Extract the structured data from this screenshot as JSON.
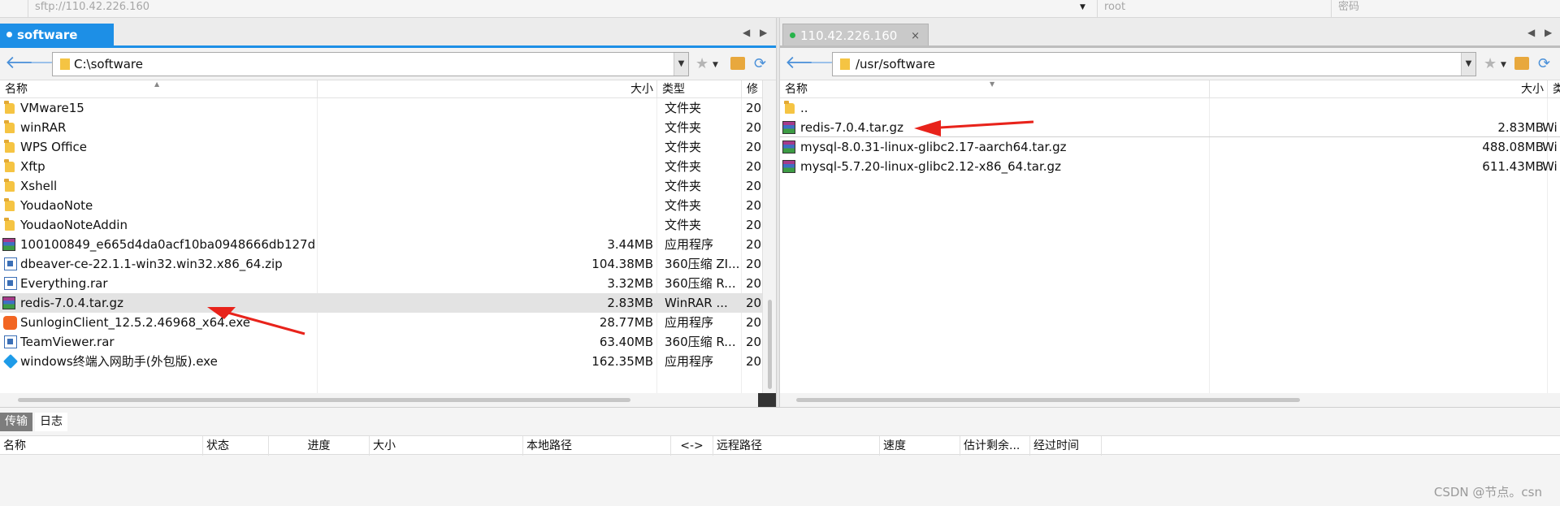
{
  "connection": {
    "host": "sftp://110.42.226.160",
    "user": "root",
    "password": "密码"
  },
  "local": {
    "tab": "software",
    "path": "C:\\software",
    "columns": {
      "name": "名称",
      "size": "大小",
      "type": "类型",
      "modified": "修"
    },
    "files": [
      {
        "name": "VMware15",
        "size": "",
        "type": "文件夹",
        "mod": "20",
        "icon": "folder"
      },
      {
        "name": "winRAR",
        "size": "",
        "type": "文件夹",
        "mod": "20",
        "icon": "folder"
      },
      {
        "name": "WPS Office",
        "size": "",
        "type": "文件夹",
        "mod": "20",
        "icon": "folder"
      },
      {
        "name": "Xftp",
        "size": "",
        "type": "文件夹",
        "mod": "20",
        "icon": "folder"
      },
      {
        "name": "Xshell",
        "size": "",
        "type": "文件夹",
        "mod": "20",
        "icon": "folder"
      },
      {
        "name": "YoudaoNote",
        "size": "",
        "type": "文件夹",
        "mod": "20",
        "icon": "folder"
      },
      {
        "name": "YoudaoNoteAddin",
        "size": "",
        "type": "文件夹",
        "mod": "20",
        "icon": "folder"
      },
      {
        "name": "100100849_e665d4da0acf10ba0948666db127d...",
        "size": "3.44MB",
        "type": "应用程序",
        "mod": "20",
        "icon": "rar"
      },
      {
        "name": "dbeaver-ce-22.1.1-win32.win32.x86_64.zip",
        "size": "104.38MB",
        "type": "360压缩 ZI...",
        "mod": "20",
        "icon": "zip"
      },
      {
        "name": "Everything.rar",
        "size": "3.32MB",
        "type": "360压缩 R...",
        "mod": "20",
        "icon": "zip"
      },
      {
        "name": "redis-7.0.4.tar.gz",
        "size": "2.83MB",
        "type": "WinRAR ...",
        "mod": "20",
        "icon": "rar"
      },
      {
        "name": "SunloginClient_12.5.2.46968_x64.exe",
        "size": "28.77MB",
        "type": "应用程序",
        "mod": "20",
        "icon": "sun"
      },
      {
        "name": "TeamViewer.rar",
        "size": "63.40MB",
        "type": "360压缩 R...",
        "mod": "20",
        "icon": "zip"
      },
      {
        "name": "windows终端入网助手(外包版).exe",
        "size": "162.35MB",
        "type": "应用程序",
        "mod": "20",
        "icon": "win"
      }
    ]
  },
  "remote": {
    "tab": "110.42.226.160",
    "path": "/usr/software",
    "columns": {
      "name": "名称",
      "size": "大小",
      "type": "类型"
    },
    "files": [
      {
        "name": "..",
        "size": "",
        "type": "",
        "icon": "folder"
      },
      {
        "name": "redis-7.0.4.tar.gz",
        "size": "2.83MB",
        "type": "Wi",
        "icon": "rar"
      },
      {
        "name": "mysql-8.0.31-linux-glibc2.17-aarch64.tar.gz",
        "size": "488.08MB",
        "type": "Wi",
        "icon": "rar"
      },
      {
        "name": "mysql-5.7.20-linux-glibc2.12-x86_64.tar.gz",
        "size": "611.43MB",
        "type": "Wi",
        "icon": "rar"
      }
    ]
  },
  "bottom": {
    "tabs": [
      "传输",
      "日志"
    ],
    "columns": [
      "名称",
      "状态",
      "进度",
      "大小",
      "本地路径",
      "<->",
      "远程路径",
      "速度",
      "估计剩余...",
      "经过时间"
    ]
  },
  "watermark": "CSDN @节点。csn",
  "colors": {
    "accent": "#1d8fe6",
    "arrow": "#e8231b"
  }
}
